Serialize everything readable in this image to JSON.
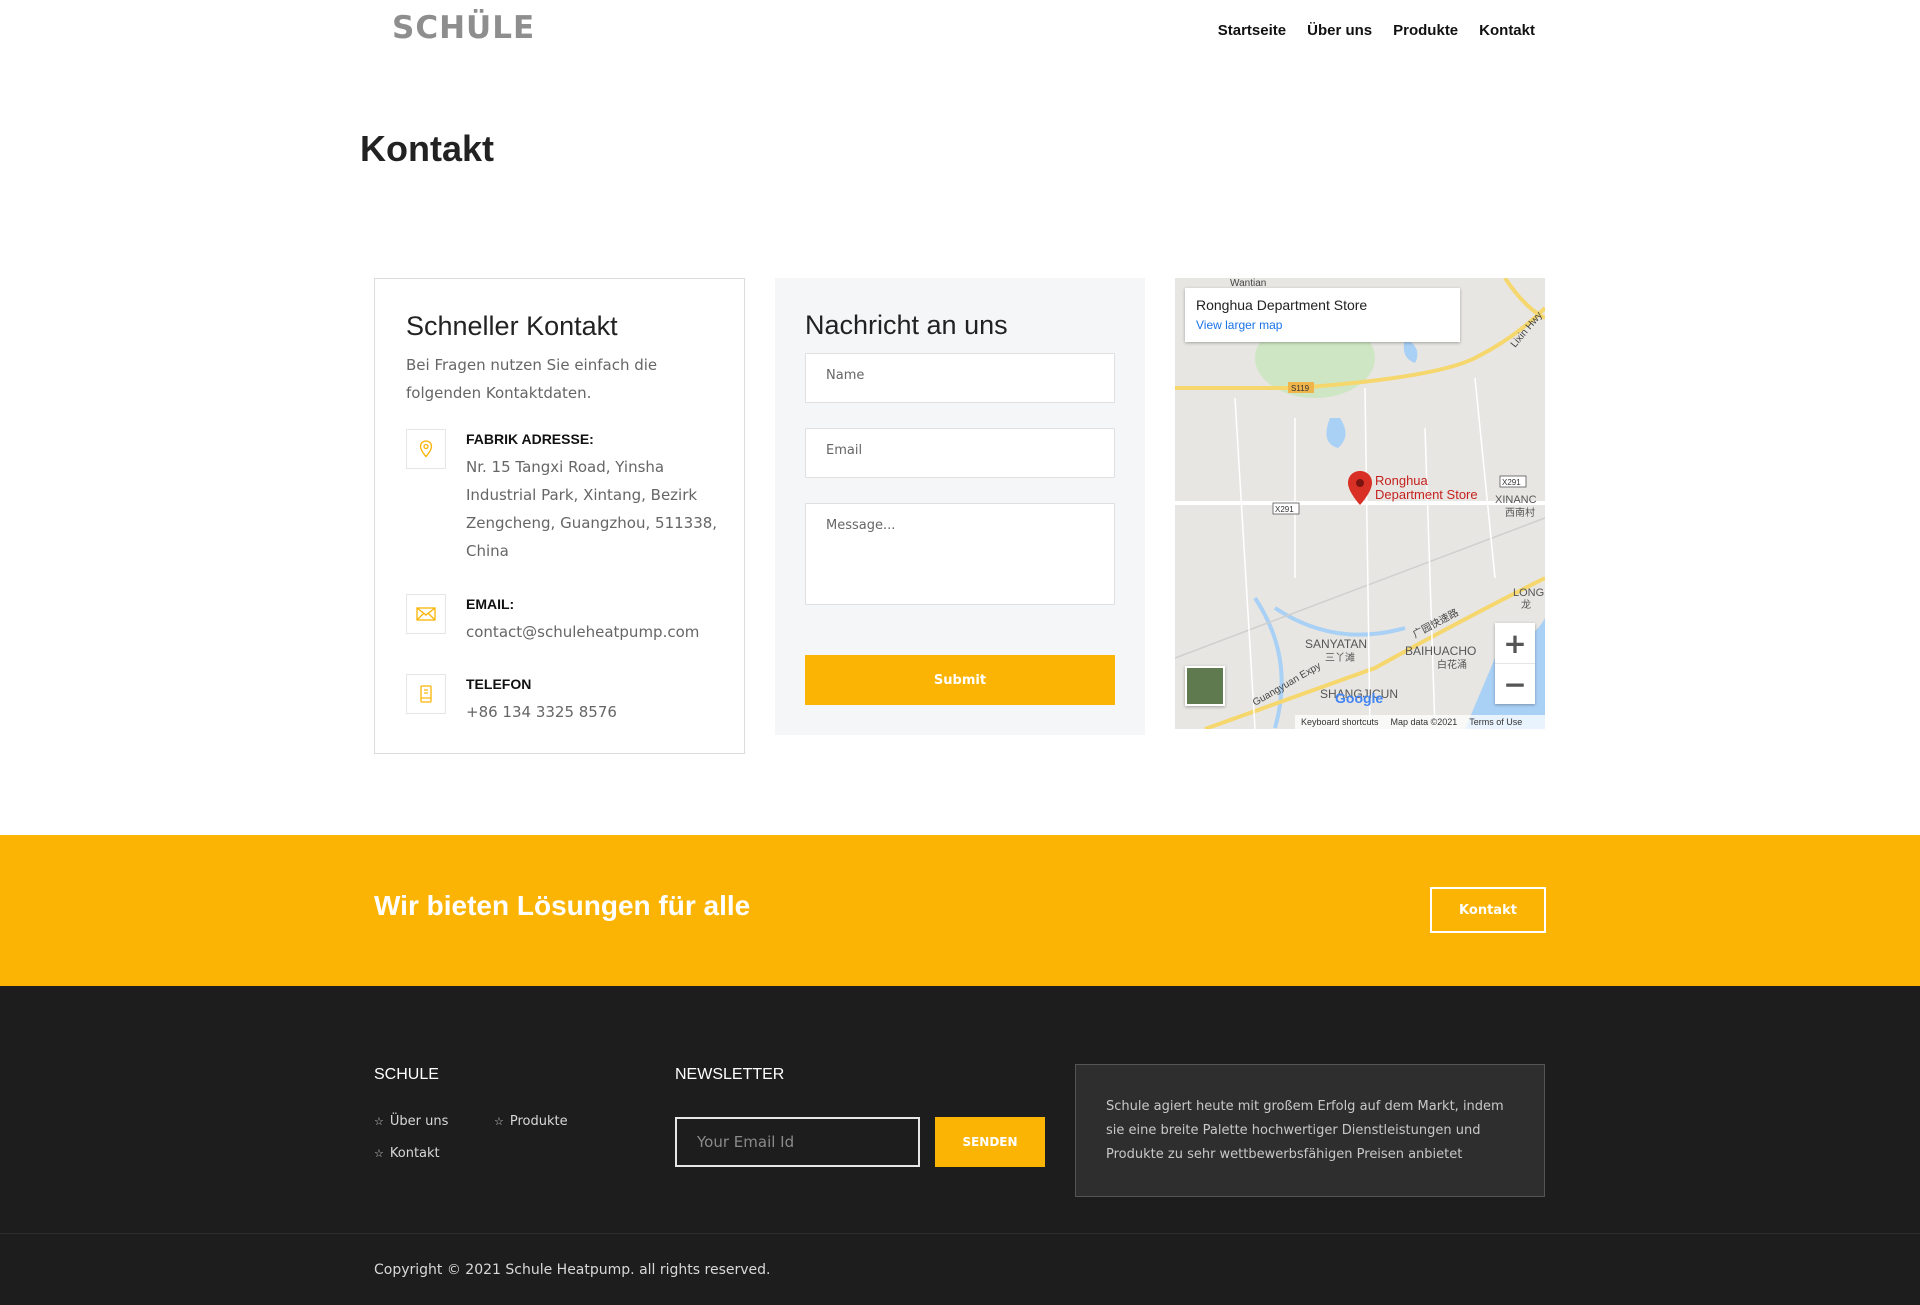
{
  "header": {
    "logo": "SCHÜLE",
    "nav": [
      "Startseite",
      "Über uns",
      "Produkte",
      "Kontakt"
    ]
  },
  "page_title": "Kontakt",
  "quick_contact": {
    "title": "Schneller Kontakt",
    "intro": "Bei Fragen nutzen Sie einfach die folgenden Kontaktdaten.",
    "address_label": "FABRIK ADRESSE:",
    "address": "Nr. 15 Tangxi Road, Yinsha Industrial Park, Xintang, Bezirk Zengcheng, Guangzhou, 511338, China",
    "email_label": "EMAIL:",
    "email": "contact@schuleheatpump.com",
    "phone_label": "TELEFON",
    "phone": "+86 134 3325 8576"
  },
  "form": {
    "title": "Nachricht an uns",
    "name_placeholder": "Name",
    "email_placeholder": "Email",
    "message_placeholder": "Message...",
    "submit": "Submit"
  },
  "map": {
    "place": "Ronghua Department Store",
    "link": "View larger map",
    "labels": [
      "Wantian",
      "Lixin Hwy",
      "S119",
      "Ronghua",
      "Department Store",
      "X291",
      "X291",
      "XINANC",
      "西南村",
      "LONG",
      "龙",
      "SANYATAN",
      "三丫滩",
      "BAIHUACHO",
      "白花涌",
      "广园快速路",
      "Guangyuan Expy",
      "SHANGJICUN"
    ],
    "footer": [
      "Keyboard shortcuts",
      "Map data ©2021",
      "Terms of Use"
    ],
    "google": "Google",
    "zoom_in": "+",
    "zoom_out": "−"
  },
  "band": {
    "headline": "Wir bieten Lösungen für alle",
    "button": "Kontakt"
  },
  "footer": {
    "col1_title": "SCHULE",
    "links": [
      "Über uns",
      "Produkte",
      "Kontakt"
    ],
    "newsletter_title": "NEWSLETTER",
    "newsletter_placeholder": "Your Email Id",
    "newsletter_button": "SENDEN",
    "about": "Schule agiert heute mit großem Erfolg auf dem Markt, indem sie eine breite Palette hochwertiger Dienstleistungen und Produkte zu sehr wettbewerbsfähigen Preisen anbietet",
    "copyright": "Copyright © 2021 Schule Heatpump. all rights reserved."
  },
  "colors": {
    "accent": "#fbb404",
    "footer_bg": "#1d1d1d",
    "map_pin": "#d93025"
  }
}
